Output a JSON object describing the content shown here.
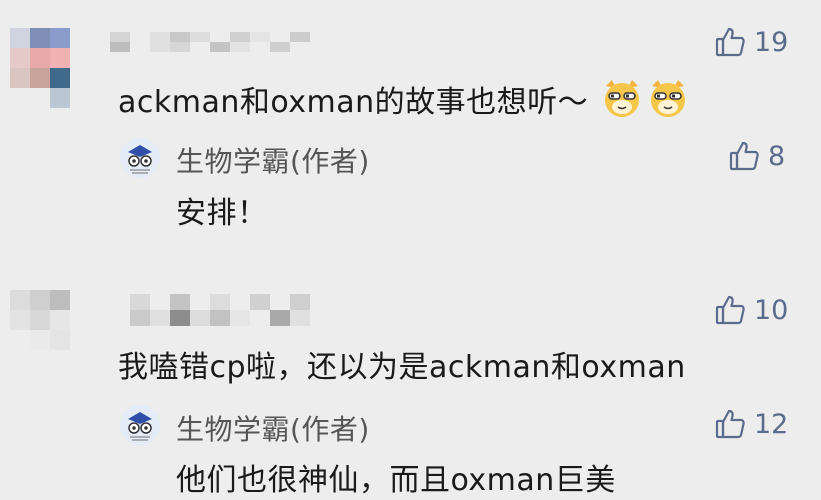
{
  "comments": [
    {
      "text": "ackman和oxman的故事也想听～",
      "likes": "19",
      "emojis": [
        "doge-emoji",
        "doge-emoji"
      ],
      "reply": {
        "author": "生物学霸(作者)",
        "text": "安排！",
        "likes": "8"
      }
    },
    {
      "text": "我嗑错cp啦，还以为是ackman和oxman",
      "likes": "10",
      "reply": {
        "author": "生物学霸(作者)",
        "text": "他们也很神仙，而且oxman巨美",
        "likes": "12"
      }
    }
  ],
  "colors": {
    "background": "#ededed",
    "like": "#5a6b8c",
    "author": "#555555",
    "text": "#1a1a1a"
  },
  "icons": {
    "like": "thumbs-up-icon",
    "reply_avatar": "owl-avatar-icon"
  }
}
